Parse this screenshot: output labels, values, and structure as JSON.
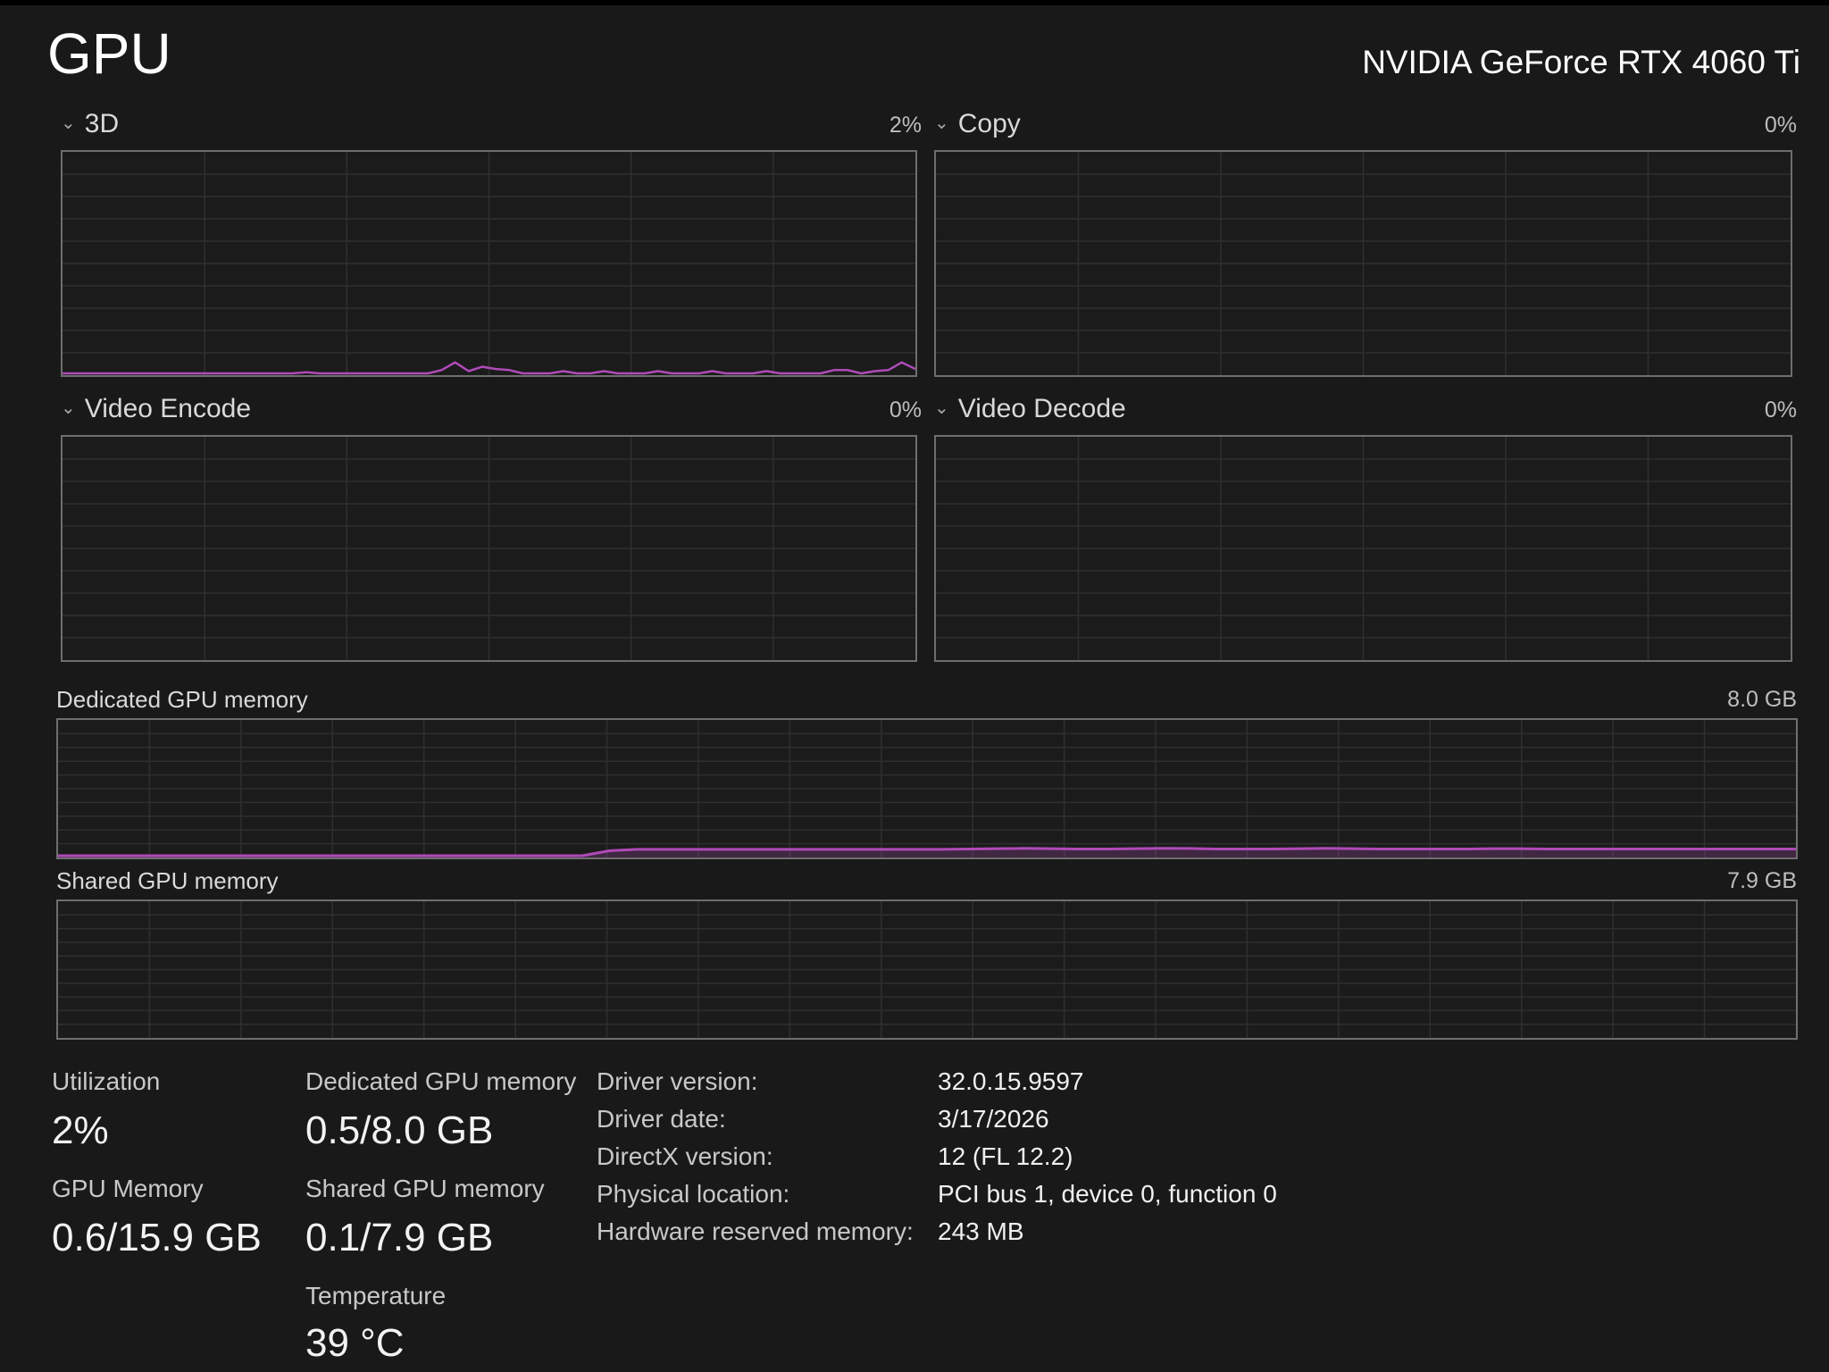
{
  "header": {
    "title": "GPU",
    "gpu_name": "NVIDIA GeForce RTX 4060 Ti"
  },
  "colors": {
    "background": "#191919",
    "graph_border": "#6e6e6e",
    "grid": "#2f2f2f",
    "line": "#b04ab8"
  },
  "engines": [
    {
      "label": "3D",
      "value": "2%"
    },
    {
      "label": "Copy",
      "value": "0%"
    },
    {
      "label": "Video Encode",
      "value": "0%"
    },
    {
      "label": "Video Decode",
      "value": "0%"
    }
  ],
  "memory_graphs": [
    {
      "label": "Dedicated GPU memory",
      "value": "8.0 GB"
    },
    {
      "label": "Shared GPU memory",
      "value": "7.9 GB"
    }
  ],
  "chart_data": [
    {
      "type": "line",
      "series": [
        {
          "values": [
            0,
            0,
            0,
            0,
            0,
            0,
            0,
            0,
            0,
            0,
            0,
            0,
            0,
            0,
            0,
            0,
            0,
            0,
            0.5,
            0,
            0,
            0,
            0,
            0,
            0,
            0,
            0,
            0,
            1.5,
            5,
            1,
            3,
            2,
            1.5,
            0,
            0,
            0,
            1,
            0,
            0,
            1,
            0,
            0,
            0,
            1,
            0,
            0,
            0,
            1,
            0,
            0,
            0,
            1,
            0,
            0,
            0,
            0,
            1.5,
            1.5,
            0,
            1,
            1.5,
            5,
            2
          ]
        }
      ],
      "ylim": [
        0,
        100
      ]
    },
    {
      "type": "line",
      "series": [
        {
          "values": [
            0,
            0,
            0,
            0,
            0,
            0,
            0,
            0,
            0,
            0,
            0,
            0,
            0,
            0,
            0,
            0,
            0,
            0,
            0,
            0,
            0,
            0,
            0,
            0,
            0,
            0,
            0,
            0,
            0,
            0,
            0,
            0,
            0,
            0,
            0,
            0,
            0,
            0,
            0,
            0,
            0,
            0,
            0,
            0,
            0,
            0,
            0,
            0,
            0,
            0,
            0,
            0,
            0,
            0,
            0,
            0,
            0,
            0,
            0,
            0,
            0,
            0,
            0,
            0
          ]
        }
      ],
      "ylim": [
        0,
        100
      ]
    },
    {
      "type": "line",
      "series": [
        {
          "values": [
            0,
            0,
            0,
            0,
            0,
            0,
            0,
            0,
            0,
            0,
            0,
            0,
            0,
            0,
            0,
            0,
            0,
            0,
            0,
            0,
            0,
            0,
            0,
            0,
            0,
            0,
            0,
            0,
            0,
            0,
            0,
            0,
            0,
            0,
            0,
            0,
            0,
            0,
            0,
            0,
            0,
            0,
            0,
            0,
            0,
            0,
            0,
            0,
            0,
            0,
            0,
            0,
            0,
            0,
            0,
            0,
            0,
            0,
            0,
            0,
            0,
            0,
            0,
            0
          ]
        }
      ],
      "ylim": [
        0,
        100
      ]
    },
    {
      "type": "line",
      "series": [
        {
          "values": [
            0,
            0,
            0,
            0,
            0,
            0,
            0,
            0,
            0,
            0,
            0,
            0,
            0,
            0,
            0,
            0,
            0,
            0,
            0,
            0,
            0,
            0,
            0,
            0,
            0,
            0,
            0,
            0,
            0,
            0,
            0,
            0,
            0,
            0,
            0,
            0,
            0,
            0,
            0,
            0,
            0,
            0,
            0,
            0,
            0,
            0,
            0,
            0,
            0,
            0,
            0,
            0,
            0,
            0,
            0,
            0,
            0,
            0,
            0,
            0,
            0,
            0,
            0,
            0
          ]
        }
      ],
      "ylim": [
        0,
        100
      ]
    },
    {
      "type": "area",
      "series": [
        {
          "values": [
            0,
            0,
            0,
            0,
            0,
            0,
            0,
            0,
            0,
            0,
            0,
            0,
            0,
            0,
            0,
            0,
            0,
            0,
            0,
            0,
            0.3,
            0.38,
            0.38,
            0.38,
            0.38,
            0.38,
            0.38,
            0.38,
            0.38,
            0.38,
            0.38,
            0.38,
            0.38,
            0.4,
            0.42,
            0.44,
            0.42,
            0.4,
            0.4,
            0.42,
            0.44,
            0.43,
            0.4,
            0.4,
            0.4,
            0.42,
            0.44,
            0.42,
            0.4,
            0.4,
            0.4,
            0.4,
            0.42,
            0.42,
            0.4,
            0.4,
            0.4,
            0.4,
            0.4,
            0.4,
            0.4,
            0.4,
            0.4,
            0.4
          ]
        }
      ],
      "ylim": [
        0,
        8
      ]
    },
    {
      "type": "area",
      "series": [
        {
          "values": [
            0,
            0,
            0,
            0,
            0,
            0,
            0,
            0,
            0,
            0,
            0,
            0,
            0,
            0,
            0,
            0,
            0,
            0,
            0,
            0,
            0,
            0,
            0,
            0,
            0,
            0,
            0,
            0,
            0,
            0,
            0,
            0,
            0,
            0,
            0,
            0,
            0,
            0,
            0,
            0,
            0,
            0,
            0,
            0,
            0,
            0,
            0,
            0,
            0,
            0,
            0,
            0,
            0,
            0,
            0,
            0,
            0,
            0,
            0,
            0,
            0,
            0,
            0,
            0
          ]
        }
      ],
      "ylim": [
        0,
        7.9
      ]
    }
  ],
  "stats": {
    "utilization_label": "Utilization",
    "utilization_value": "2%",
    "gpu_memory_label": "GPU Memory",
    "gpu_memory_value": "0.6/15.9 GB",
    "dedicated_label": "Dedicated GPU memory",
    "dedicated_value": "0.5/8.0 GB",
    "shared_label": "Shared GPU memory",
    "shared_value": "0.1/7.9 GB",
    "temperature_label": "Temperature",
    "temperature_value": "39 °C"
  },
  "info": [
    {
      "key": "Driver version:",
      "value": "32.0.15.9597"
    },
    {
      "key": "Driver date:",
      "value": "3/17/2026"
    },
    {
      "key": "DirectX version:",
      "value": "12 (FL 12.2)"
    },
    {
      "key": "Physical location:",
      "value": "PCI bus 1, device 0, function 0"
    },
    {
      "key": "Hardware reserved memory:",
      "value": "243 MB"
    }
  ]
}
